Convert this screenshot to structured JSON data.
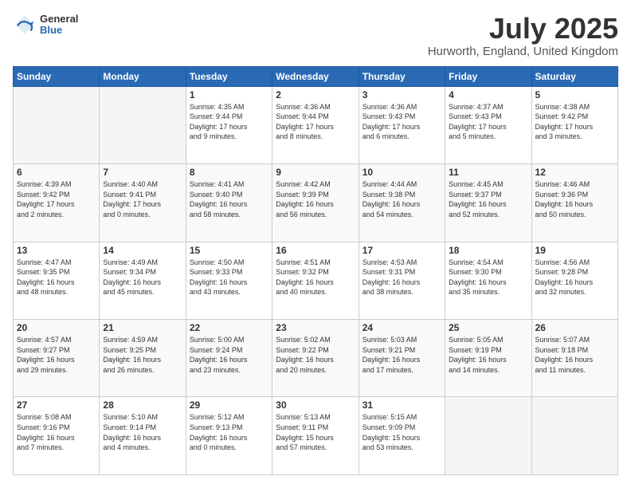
{
  "logo": {
    "line1": "General",
    "line2": "Blue"
  },
  "title": "July 2025",
  "subtitle": "Hurworth, England, United Kingdom",
  "weekdays": [
    "Sunday",
    "Monday",
    "Tuesday",
    "Wednesday",
    "Thursday",
    "Friday",
    "Saturday"
  ],
  "weeks": [
    [
      {
        "day": "",
        "info": ""
      },
      {
        "day": "",
        "info": ""
      },
      {
        "day": "1",
        "info": "Sunrise: 4:35 AM\nSunset: 9:44 PM\nDaylight: 17 hours\nand 9 minutes."
      },
      {
        "day": "2",
        "info": "Sunrise: 4:36 AM\nSunset: 9:44 PM\nDaylight: 17 hours\nand 8 minutes."
      },
      {
        "day": "3",
        "info": "Sunrise: 4:36 AM\nSunset: 9:43 PM\nDaylight: 17 hours\nand 6 minutes."
      },
      {
        "day": "4",
        "info": "Sunrise: 4:37 AM\nSunset: 9:43 PM\nDaylight: 17 hours\nand 5 minutes."
      },
      {
        "day": "5",
        "info": "Sunrise: 4:38 AM\nSunset: 9:42 PM\nDaylight: 17 hours\nand 3 minutes."
      }
    ],
    [
      {
        "day": "6",
        "info": "Sunrise: 4:39 AM\nSunset: 9:42 PM\nDaylight: 17 hours\nand 2 minutes."
      },
      {
        "day": "7",
        "info": "Sunrise: 4:40 AM\nSunset: 9:41 PM\nDaylight: 17 hours\nand 0 minutes."
      },
      {
        "day": "8",
        "info": "Sunrise: 4:41 AM\nSunset: 9:40 PM\nDaylight: 16 hours\nand 58 minutes."
      },
      {
        "day": "9",
        "info": "Sunrise: 4:42 AM\nSunset: 9:39 PM\nDaylight: 16 hours\nand 56 minutes."
      },
      {
        "day": "10",
        "info": "Sunrise: 4:44 AM\nSunset: 9:38 PM\nDaylight: 16 hours\nand 54 minutes."
      },
      {
        "day": "11",
        "info": "Sunrise: 4:45 AM\nSunset: 9:37 PM\nDaylight: 16 hours\nand 52 minutes."
      },
      {
        "day": "12",
        "info": "Sunrise: 4:46 AM\nSunset: 9:36 PM\nDaylight: 16 hours\nand 50 minutes."
      }
    ],
    [
      {
        "day": "13",
        "info": "Sunrise: 4:47 AM\nSunset: 9:35 PM\nDaylight: 16 hours\nand 48 minutes."
      },
      {
        "day": "14",
        "info": "Sunrise: 4:49 AM\nSunset: 9:34 PM\nDaylight: 16 hours\nand 45 minutes."
      },
      {
        "day": "15",
        "info": "Sunrise: 4:50 AM\nSunset: 9:33 PM\nDaylight: 16 hours\nand 43 minutes."
      },
      {
        "day": "16",
        "info": "Sunrise: 4:51 AM\nSunset: 9:32 PM\nDaylight: 16 hours\nand 40 minutes."
      },
      {
        "day": "17",
        "info": "Sunrise: 4:53 AM\nSunset: 9:31 PM\nDaylight: 16 hours\nand 38 minutes."
      },
      {
        "day": "18",
        "info": "Sunrise: 4:54 AM\nSunset: 9:30 PM\nDaylight: 16 hours\nand 35 minutes."
      },
      {
        "day": "19",
        "info": "Sunrise: 4:56 AM\nSunset: 9:28 PM\nDaylight: 16 hours\nand 32 minutes."
      }
    ],
    [
      {
        "day": "20",
        "info": "Sunrise: 4:57 AM\nSunset: 9:27 PM\nDaylight: 16 hours\nand 29 minutes."
      },
      {
        "day": "21",
        "info": "Sunrise: 4:59 AM\nSunset: 9:25 PM\nDaylight: 16 hours\nand 26 minutes."
      },
      {
        "day": "22",
        "info": "Sunrise: 5:00 AM\nSunset: 9:24 PM\nDaylight: 16 hours\nand 23 minutes."
      },
      {
        "day": "23",
        "info": "Sunrise: 5:02 AM\nSunset: 9:22 PM\nDaylight: 16 hours\nand 20 minutes."
      },
      {
        "day": "24",
        "info": "Sunrise: 5:03 AM\nSunset: 9:21 PM\nDaylight: 16 hours\nand 17 minutes."
      },
      {
        "day": "25",
        "info": "Sunrise: 5:05 AM\nSunset: 9:19 PM\nDaylight: 16 hours\nand 14 minutes."
      },
      {
        "day": "26",
        "info": "Sunrise: 5:07 AM\nSunset: 9:18 PM\nDaylight: 16 hours\nand 11 minutes."
      }
    ],
    [
      {
        "day": "27",
        "info": "Sunrise: 5:08 AM\nSunset: 9:16 PM\nDaylight: 16 hours\nand 7 minutes."
      },
      {
        "day": "28",
        "info": "Sunrise: 5:10 AM\nSunset: 9:14 PM\nDaylight: 16 hours\nand 4 minutes."
      },
      {
        "day": "29",
        "info": "Sunrise: 5:12 AM\nSunset: 9:13 PM\nDaylight: 16 hours\nand 0 minutes."
      },
      {
        "day": "30",
        "info": "Sunrise: 5:13 AM\nSunset: 9:11 PM\nDaylight: 15 hours\nand 57 minutes."
      },
      {
        "day": "31",
        "info": "Sunrise: 5:15 AM\nSunset: 9:09 PM\nDaylight: 15 hours\nand 53 minutes."
      },
      {
        "day": "",
        "info": ""
      },
      {
        "day": "",
        "info": ""
      }
    ]
  ]
}
